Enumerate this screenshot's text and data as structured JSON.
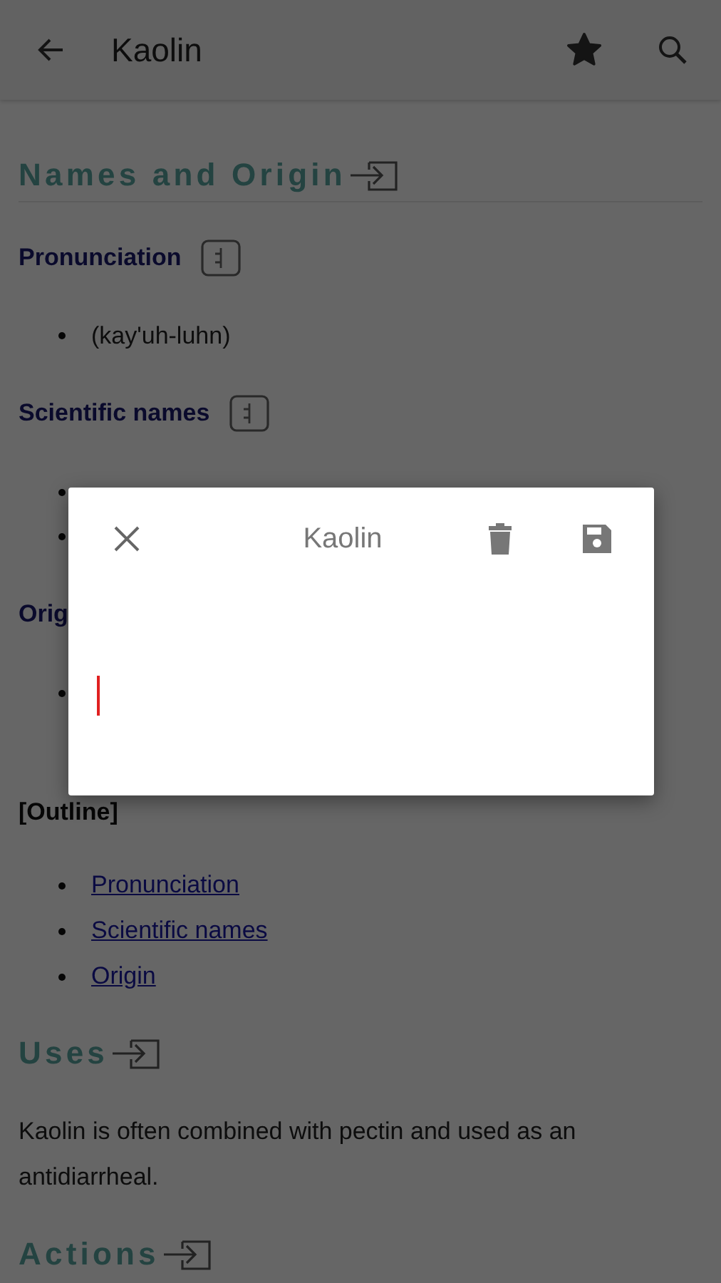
{
  "app_bar": {
    "title": "Kaolin",
    "favorite": true
  },
  "blocks": [
    {
      "kind": "section_heading",
      "text": "Names and Origin",
      "underlined": true
    },
    {
      "kind": "subheading",
      "text": "Pronunciation",
      "jump": true
    },
    {
      "kind": "bullets",
      "items": [
        {
          "text": "(kay'uh-luhn)",
          "covered": false
        }
      ]
    },
    {
      "kind": "subheading",
      "text": "Scientific names",
      "jump": true
    },
    {
      "kind": "bullets",
      "items": [
        {
          "covered": true
        },
        {
          "covered": true
        }
      ]
    },
    {
      "kind": "subheading",
      "text": "Orig"
    },
    {
      "kind": "bullets",
      "items": [
        {
          "covered": true
        }
      ]
    },
    {
      "kind": "label",
      "text": "[Outline]"
    },
    {
      "kind": "links",
      "items": [
        "Pronunciation",
        "Scientific names",
        "Origin"
      ]
    },
    {
      "kind": "section_heading",
      "text": "Uses",
      "underlined": false
    },
    {
      "kind": "paragraph",
      "text": "Kaolin is often combined with pectin and used as an antidiarrheal."
    },
    {
      "kind": "section_heading",
      "text": "Actions",
      "underlined": false
    }
  ],
  "dialog": {
    "title": "Kaolin",
    "note_focused": true
  }
}
